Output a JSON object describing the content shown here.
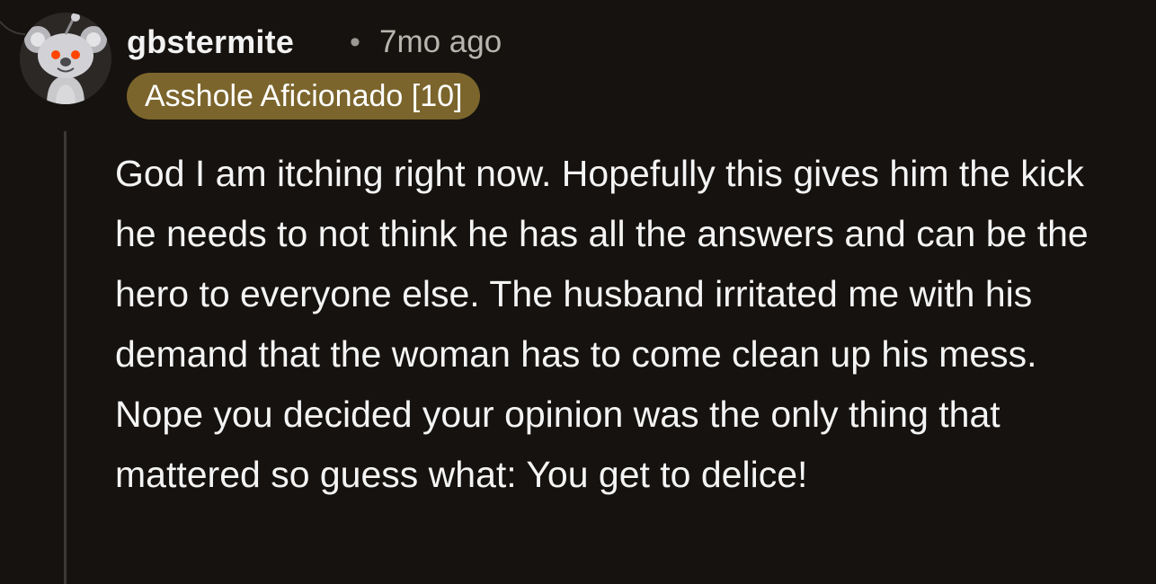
{
  "comment": {
    "author": "gbstermite",
    "separator": "•",
    "timestamp": "7mo ago",
    "flair": "Asshole Aficionado [10]",
    "body": "God I am itching right now. Hopefully this gives him the kick he needs to not think he has all the answers and can be the hero to everyone else. The husband irritated me with his demand that the woman has to come clean up his mess. Nope you decided your opinion was the only thing that mattered so guess what: You get to delice!"
  },
  "icons": {
    "avatar": "snoo-koala-avatar-icon"
  },
  "colors": {
    "background": "#15120f",
    "flair_background": "#7b652c",
    "text": "#f4f4f4",
    "meta_text": "#b8b4ae",
    "thread_line": "#3b3835"
  }
}
